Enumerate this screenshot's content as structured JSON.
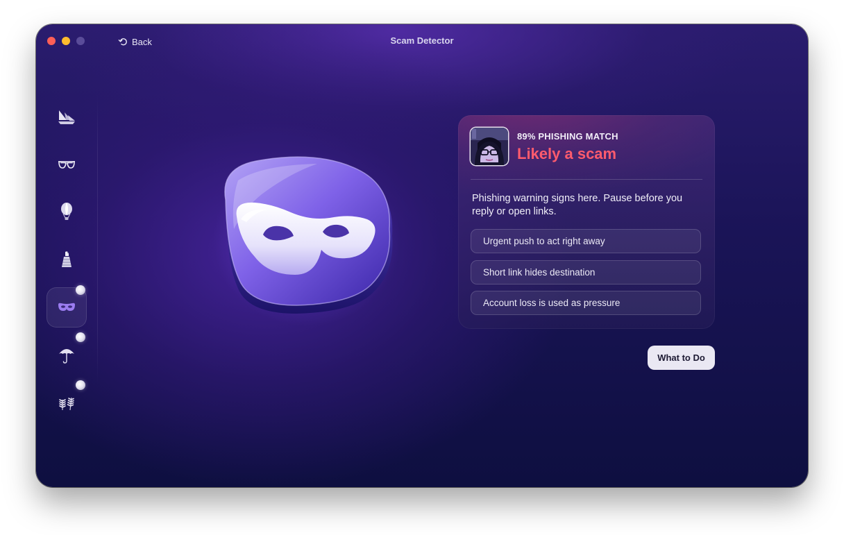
{
  "window": {
    "title": "Scam Detector",
    "back_label": "Back"
  },
  "sidebar": {
    "items": [
      {
        "name": "sidebar-item-boat",
        "icon": "sailboat-icon"
      },
      {
        "name": "sidebar-item-glasses",
        "icon": "sunglasses-icon"
      },
      {
        "name": "sidebar-item-balloon",
        "icon": "hot-air-balloon-icon"
      },
      {
        "name": "sidebar-item-lighthouse",
        "icon": "bird-on-tower-icon"
      },
      {
        "name": "sidebar-item-scam-detector",
        "icon": "mask-icon",
        "active": true
      },
      {
        "name": "sidebar-item-umbrella",
        "icon": "umbrella-icon"
      },
      {
        "name": "sidebar-item-plants",
        "icon": "fern-icon"
      }
    ]
  },
  "result": {
    "match_label": "89% PHISHING MATCH",
    "verdict": "Likely a scam",
    "verdict_color": "#ff5b6d",
    "description": "Phishing warning signs here. Pause before you reply or open links.",
    "signs": [
      "Urgent push to act right away",
      "Short link hides destination",
      "Account loss is used as pressure"
    ]
  },
  "actions": {
    "what_to_do": "What to Do"
  }
}
